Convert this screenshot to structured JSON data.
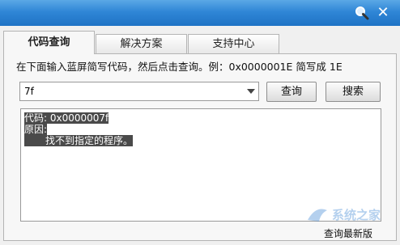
{
  "tabs": [
    {
      "label": "代码查询",
      "active": true
    },
    {
      "label": "解决方案",
      "active": false
    },
    {
      "label": "支持中心",
      "active": false
    }
  ],
  "instruction": "在下面输入蓝屏简写代码，然后点击查询。例：0x0000001E 简写成 1E",
  "code_input": {
    "value": "7f"
  },
  "buttons": {
    "query_label": "查询",
    "search_label": "搜索"
  },
  "result": {
    "code_line": "代码: 0x0000007f",
    "reason_label": "原因:",
    "reason_text": "找不到指定的程序。"
  },
  "footer": {
    "button_label": "查询最新版"
  },
  "watermark": {
    "text": "系统之家"
  },
  "colors": {
    "titlebar": "#2f86d6",
    "highlight": "#4a4a4a"
  }
}
